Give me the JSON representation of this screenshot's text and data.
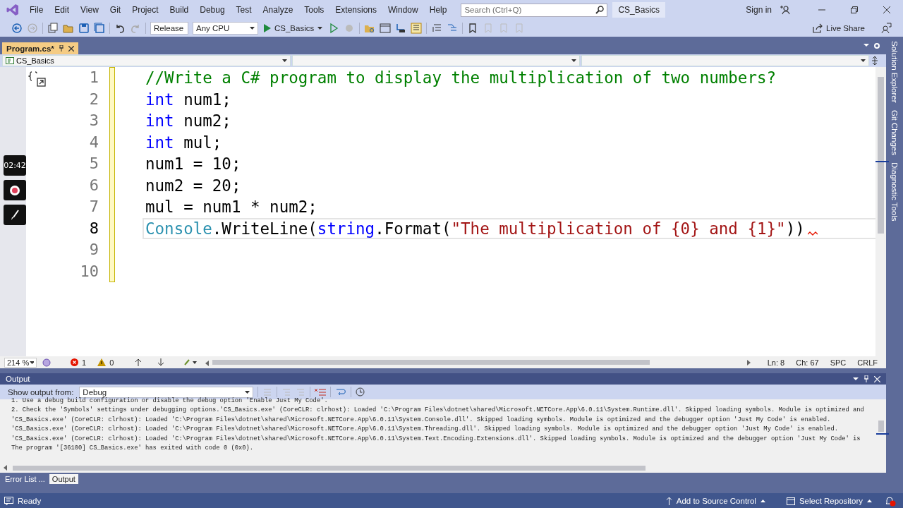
{
  "menu": [
    "File",
    "Edit",
    "View",
    "Git",
    "Project",
    "Build",
    "Debug",
    "Test",
    "Analyze",
    "Tools",
    "Extensions",
    "Window",
    "Help"
  ],
  "search": {
    "placeholder": "Search (Ctrl+Q)"
  },
  "solution_name": "CS_Basics",
  "sign_in": "Sign in",
  "toolbar": {
    "configuration": "Release",
    "platform": "Any CPU",
    "startup": "CS_Basics",
    "live_share": "Live Share"
  },
  "document_tabs": [
    {
      "label": "Program.cs*",
      "selected": true
    }
  ],
  "nav_bar": {
    "project": "CS_Basics"
  },
  "recorder": {
    "time": "02:42"
  },
  "editor": {
    "lines": [
      {
        "number": "1",
        "current": false,
        "error": false,
        "tokens": [
          {
            "kind": "comment",
            "text": "//Write a C# program to display the multiplication of two numbers?"
          }
        ]
      },
      {
        "number": "2",
        "current": false,
        "error": false,
        "tokens": [
          {
            "kind": "keyword",
            "text": "int"
          },
          {
            "kind": "plain",
            "text": " num1;"
          }
        ]
      },
      {
        "number": "3",
        "current": false,
        "error": false,
        "tokens": [
          {
            "kind": "keyword",
            "text": "int"
          },
          {
            "kind": "plain",
            "text": " num2;"
          }
        ]
      },
      {
        "number": "4",
        "current": false,
        "error": false,
        "tokens": [
          {
            "kind": "keyword",
            "text": "int"
          },
          {
            "kind": "plain",
            "text": " mul;"
          }
        ]
      },
      {
        "number": "5",
        "current": false,
        "error": false,
        "tokens": [
          {
            "kind": "plain",
            "text": "num1 = 10;"
          }
        ]
      },
      {
        "number": "6",
        "current": false,
        "error": false,
        "tokens": [
          {
            "kind": "plain",
            "text": "num2 = 20;"
          }
        ]
      },
      {
        "number": "7",
        "current": false,
        "error": false,
        "tokens": [
          {
            "kind": "plain",
            "text": "mul = num1 * num2;"
          }
        ]
      },
      {
        "number": "8",
        "current": true,
        "error": true,
        "tokens": [
          {
            "kind": "type",
            "text": "Console"
          },
          {
            "kind": "plain",
            "text": ".WriteLine("
          },
          {
            "kind": "keyword",
            "text": "string"
          },
          {
            "kind": "plain",
            "text": ".Format("
          },
          {
            "kind": "string",
            "text": "\"The multiplication of {0} and {1}\""
          },
          {
            "kind": "plain",
            "text": "))"
          }
        ]
      },
      {
        "number": "9",
        "current": false,
        "error": false
      },
      {
        "number": "10",
        "current": false,
        "error": false
      }
    ]
  },
  "editor_status": {
    "zoom": "214 %",
    "errors": "1",
    "warnings": "0",
    "line": "Ln: 8",
    "column": "Ch: 67",
    "whitespace": "SPC",
    "line_ending": "CRLF"
  },
  "side_tabs": [
    "Solution Explorer",
    "Git Changes",
    "Diagnostic Tools"
  ],
  "output": {
    "title": "Output",
    "source_label": "Show output from:",
    "source": "Debug",
    "lines": [
      "1. Use a debug build configuration or disable the debug option 'Enable Just My Code'.",
      "2. Check the 'Symbols' settings under debugging options.'CS_Basics.exe' (CoreCLR: clrhost): Loaded 'C:\\Program Files\\dotnet\\shared\\Microsoft.NETCore.App\\6.0.11\\System.Runtime.dll'. Skipped loading symbols. Module is optimized and",
      "'CS_Basics.exe' (CoreCLR: clrhost): Loaded 'C:\\Program Files\\dotnet\\shared\\Microsoft.NETCore.App\\6.0.11\\System.Console.dll'. Skipped loading symbols. Module is optimized and the debugger option 'Just My Code' is enabled.",
      "'CS_Basics.exe' (CoreCLR: clrhost): Loaded 'C:\\Program Files\\dotnet\\shared\\Microsoft.NETCore.App\\6.0.11\\System.Threading.dll'. Skipped loading symbols. Module is optimized and the debugger option 'Just My Code' is enabled.",
      "'CS_Basics.exe' (CoreCLR: clrhost): Loaded 'C:\\Program Files\\dotnet\\shared\\Microsoft.NETCore.App\\6.0.11\\System.Text.Encoding.Extensions.dll'. Skipped loading symbols. Module is optimized and the debugger option 'Just My Code' is",
      "The program '[36100] CS_Basics.exe' has exited with code 0 (0x0)."
    ]
  },
  "bottom_tabs": [
    {
      "label": "Error List ...",
      "selected": false
    },
    {
      "label": "Output",
      "selected": true
    }
  ],
  "status_bar": {
    "ready": "Ready",
    "source_control": "Add to Source Control",
    "repository": "Select Repository"
  }
}
